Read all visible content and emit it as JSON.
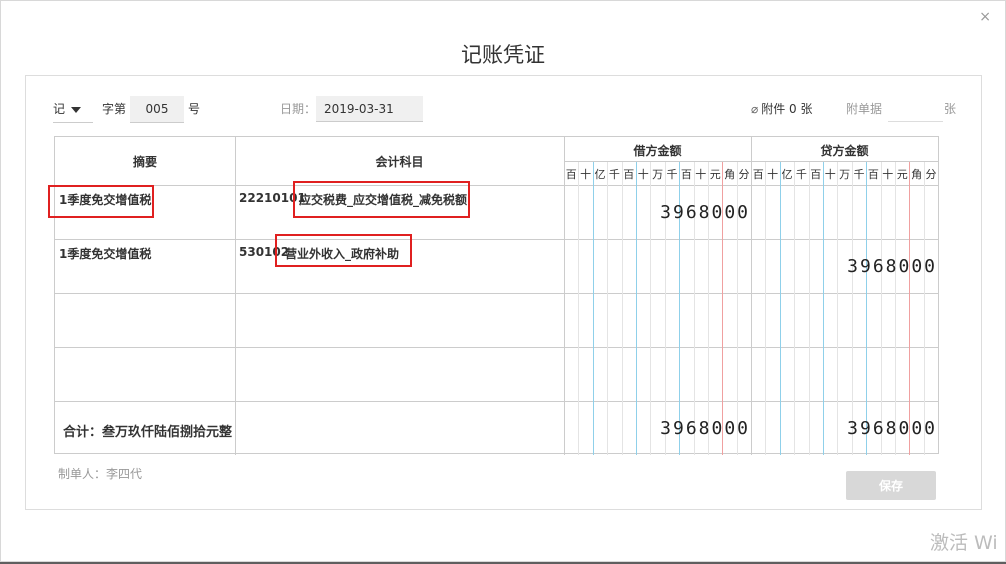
{
  "dialog": {
    "title": "记账凭证",
    "close": "×"
  },
  "header": {
    "word": "记",
    "word_suffix": "字第",
    "voucher_no": "005",
    "no_suffix": "号",
    "date_label": "日期：",
    "date": "2019-03-31",
    "attachment": "附件 0 张",
    "receipt_label": "附单据",
    "receipt_count": "",
    "receipt_unit": "张"
  },
  "table": {
    "col_summary": "摘要",
    "col_account": "会计科目",
    "col_debit": "借方金额",
    "col_credit": "贷方金额",
    "digit_units": [
      "百",
      "十",
      "亿",
      "千",
      "百",
      "十",
      "万",
      "千",
      "百",
      "十",
      "元",
      "角",
      "分"
    ],
    "rows": [
      {
        "summary": "1季度免交增值税",
        "account_code": "22210101",
        "account_name": "应交税费_应交增值税_减免税额",
        "debit": "3968000",
        "credit": ""
      },
      {
        "summary": "1季度免交增值税",
        "account_code": "530102",
        "account_name": "营业外收入_政府补助",
        "debit": "",
        "credit": "3968000"
      },
      {
        "summary": "",
        "account_code": "",
        "account_name": "",
        "debit": "",
        "credit": ""
      },
      {
        "summary": "",
        "account_code": "",
        "account_name": "",
        "debit": "",
        "credit": ""
      }
    ],
    "total_label": "合计：",
    "total_text": "叁万玖仟陆佰捌拾元整",
    "total_debit": "3968000",
    "total_credit": "3968000"
  },
  "footer": {
    "maker": "制单人：李四代",
    "save": "保存"
  },
  "watermark": "激活 Wi",
  "colors": {
    "highlight": "#e02020",
    "grid_blue": "#8fd0ea",
    "grid_red": "#f0a0a0"
  },
  "icons": {
    "close": "close-icon",
    "dropdown": "caret-down-icon",
    "attachment": "paperclip-icon"
  }
}
